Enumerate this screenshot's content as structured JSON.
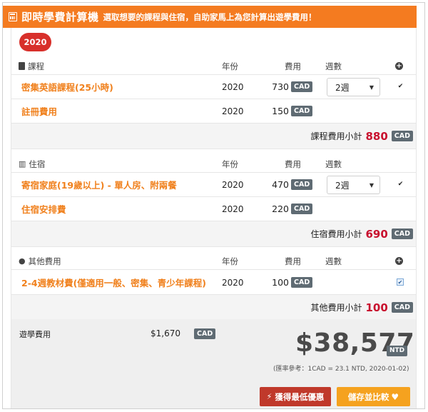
{
  "header": {
    "title": "即時學費計算機",
    "subtitle": "選取想要的課程與住宿，自助家馬上為您計算出遊學費用！"
  },
  "year_badge": "2020",
  "columns": {
    "year": "年份",
    "fee": "費用",
    "weeks": "週數"
  },
  "currency": "CAD",
  "course": {
    "section_label": "課程",
    "items": [
      {
        "name": "密集英語課程(25小時)",
        "year": "2020",
        "price": "730",
        "weeks": "2週",
        "checked": true
      },
      {
        "name": "註冊費用",
        "year": "2020",
        "price": "150"
      }
    ],
    "subtotal_label": "課程費用小計",
    "subtotal_value": "880"
  },
  "lodging": {
    "section_label": "住宿",
    "items": [
      {
        "name": "寄宿家庭(19歲以上) - 單人房、附兩餐",
        "year": "2020",
        "price": "470",
        "weeks": "2週",
        "checked": true
      },
      {
        "name": "住宿安排費",
        "year": "2020",
        "price": "220"
      }
    ],
    "subtotal_label": "住宿費用小計",
    "subtotal_value": "690"
  },
  "other": {
    "section_label": "其他費用",
    "items": [
      {
        "name": "2-4週教材費(僅適用一般、密集、青少年課程)",
        "year": "2020",
        "price": "100",
        "checked": true
      }
    ],
    "subtotal_label": "其他費用小計",
    "subtotal_value": "100"
  },
  "summary": {
    "label": "遊學費用",
    "total_cad": "$1,670",
    "total_ntd": "$38,577",
    "ntd_unit": "NTD",
    "rate_note": "(匯率參考：1CAD = 23.1 NTD, 2020-01-02)"
  },
  "buttons": {
    "best_offer": "獲得最低優惠",
    "save_compare": "儲存並比較"
  },
  "colors": {
    "header": "#f47b20",
    "accent_orange": "#f0801c",
    "subtotal_red": "#c8102e",
    "button_red": "#c0392b",
    "button_orange": "#f5a21f"
  }
}
